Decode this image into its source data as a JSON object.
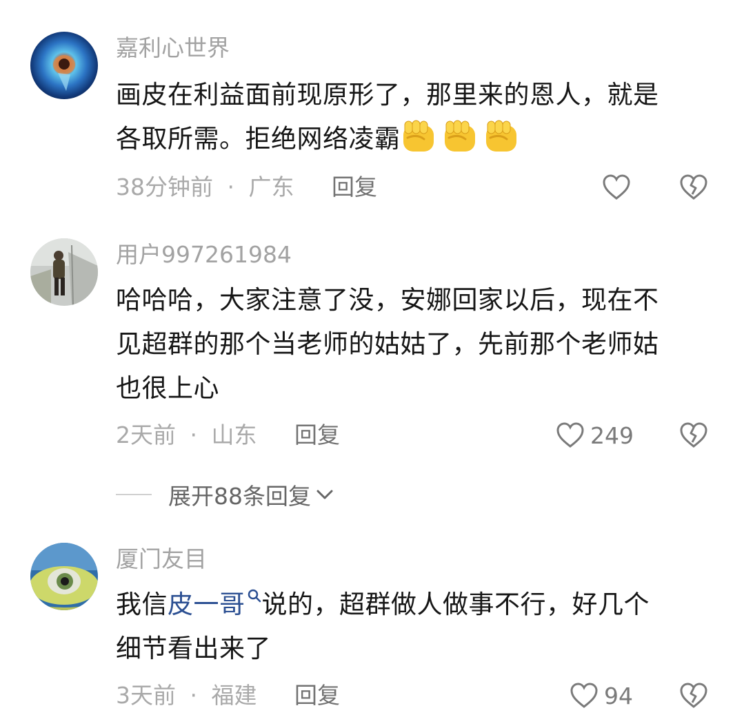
{
  "comments": [
    {
      "username": "嘉利心世界",
      "lines": [
        "画皮在利益面前现原形了，那里来的恩人，就是",
        "各取所需。拒绝网络凌霸"
      ],
      "emojis": [
        "fist-emoji",
        "fist-emoji",
        "fist-emoji"
      ],
      "time": "38分钟前",
      "location": "广东",
      "reply_label": "回复",
      "likes": ""
    },
    {
      "username": "用户997261984",
      "lines": [
        "哈哈哈，大家注意了没，安娜回家以后，现在不",
        "见超群的那个当老师的姑姑了，先前那个老师姑",
        "也很上心"
      ],
      "time": "2天前",
      "location": "山东",
      "reply_label": "回复",
      "likes": "249"
    },
    {
      "username": "厦门友目",
      "line1_prefix": "我信",
      "link_text": "皮一哥",
      "line1_suffix": "说的，超群做人做事不行，好几个",
      "line2": "细节看出来了",
      "time": "3天前",
      "location": "福建",
      "reply_label": "回复",
      "likes": "94"
    }
  ],
  "expand_replies": "展开88条回复",
  "separator": "·",
  "colors": {
    "text": "#161616",
    "username": "#a2a2a2",
    "meta": "#a9a9a9",
    "link": "#2b4f92",
    "emoji": "#f7c531"
  }
}
